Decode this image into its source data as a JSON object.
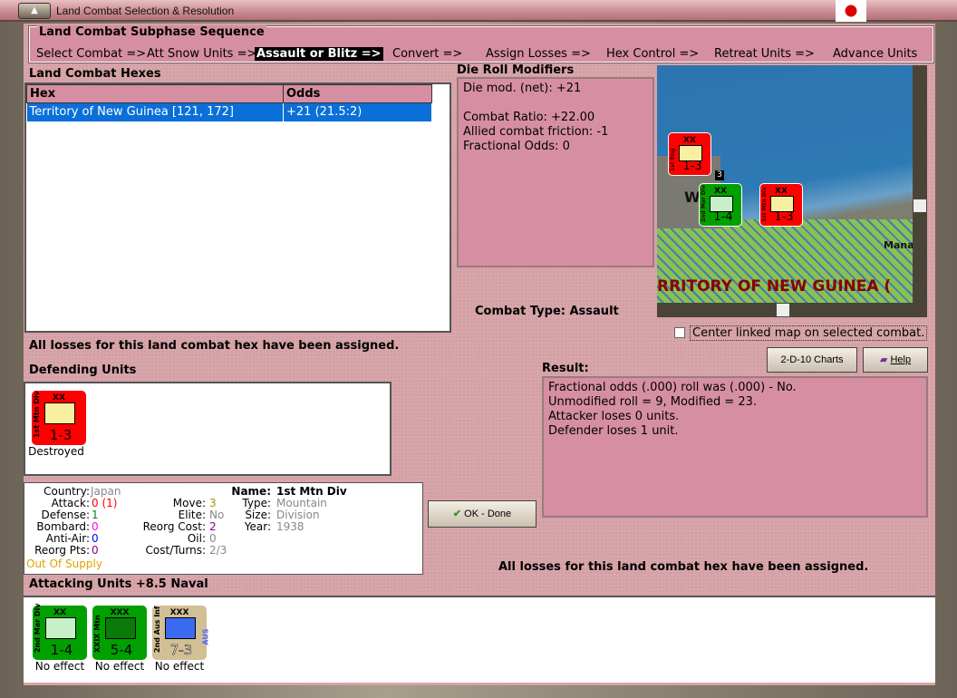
{
  "window": {
    "title": "Land Combat Selection & Resolution"
  },
  "sequence": {
    "title": "Land Combat Subphase Sequence",
    "steps": [
      "Select Combat =>",
      "Att Snow Units =>",
      "Assault or Blitz =>",
      "Convert =>",
      "Assign Losses =>",
      "Hex Control =>",
      "Retreat Units =>",
      "Advance Units"
    ],
    "active": 2
  },
  "hexes": {
    "title": "Land Combat Hexes",
    "columns": [
      "Hex",
      "Odds"
    ],
    "rows": [
      {
        "hex": "Territory of New Guinea [121, 172]",
        "odds": "+21 (21.5:2)"
      }
    ],
    "status": "All losses for this land combat hex have been assigned."
  },
  "modifiers": {
    "title": "Die Roll Modifiers",
    "lines": [
      "Die mod. (net): +21",
      "",
      "Combat Ratio: +22.00",
      "Allied combat friction: -1",
      "Fractional Odds: 0"
    ]
  },
  "combat_type": {
    "label": "Combat Type:",
    "value": "Assault"
  },
  "map": {
    "region_label": "RRITORY OF NEW GUINEA (",
    "place_label": "Mana",
    "town_label": "W",
    "stack_count": "3",
    "units": [
      {
        "name": "1st Eng",
        "strength": "1-3",
        "size": "XX"
      },
      {
        "name": "2nd Mar Div",
        "strength": "1-4",
        "size": "XX"
      },
      {
        "name": "1st Mtn Div",
        "strength": "1-3",
        "size": "XX"
      }
    ]
  },
  "center_linked": {
    "label": "Center linked map on selected combat.",
    "checked": false
  },
  "buttons": {
    "charts": "2-D-10 Charts",
    "help": "Help",
    "ok": "OK - Done"
  },
  "defending": {
    "title": "Defending Units",
    "units": [
      {
        "name": "1st Mtn Div",
        "size": "XX",
        "strength": "1-3",
        "result": "Destroyed"
      }
    ]
  },
  "unit_info": {
    "country_l": "Country:",
    "country": "Japan",
    "attack_l": "Attack:",
    "attack": "0 (1)",
    "defense_l": "Defense:",
    "defense": "1",
    "bombard_l": "Bombard:",
    "bombard": "0",
    "aa_l": "Anti-Air:",
    "aa": "0",
    "reorg_l": "Reorg Pts:",
    "reorg": "0",
    "supply": "Out Of Supply",
    "move_l": "Move:",
    "move": "3",
    "elite_l": "Elite:",
    "elite": "No",
    "reorgcost_l": "Reorg Cost:",
    "reorgcost": "2",
    "oil_l": "Oil:",
    "oil": "0",
    "cost_l": "Cost/Turns:",
    "cost": "2/3",
    "name_l": "Name:",
    "name": "1st Mtn Div",
    "type_l": "Type:",
    "type": "Mountain",
    "size_l": "Size:",
    "size": "Division",
    "year_l": "Year:",
    "year": "1938"
  },
  "result": {
    "title": "Result:",
    "lines": [
      "Fractional odds (.000) roll was (.000)  - No.",
      "Unmodified roll = 9, Modified = 23.",
      "Attacker loses 0 units.",
      "Defender loses 1 unit."
    ],
    "status": "All losses for this land combat hex have been assigned."
  },
  "attacking": {
    "title": "Attacking Units +8.5 Naval",
    "units": [
      {
        "name": "2nd Mar Div",
        "size": "XX",
        "strength": "1-4",
        "result": "No effect",
        "nation": ""
      },
      {
        "name": "XXIX Mtn",
        "size": "XXX",
        "strength": "5-4",
        "result": "No effect",
        "nation": ""
      },
      {
        "name": "2nd Aus Inf",
        "size": "XXX",
        "strength": "7-3",
        "result": "No effect",
        "nation": "AUS"
      }
    ]
  },
  "colors": {
    "japan": "#ff0000",
    "us": "#00a000",
    "aus": "#d2bf94",
    "panel": "#d68fa2",
    "selection": "#0a6fd8"
  }
}
